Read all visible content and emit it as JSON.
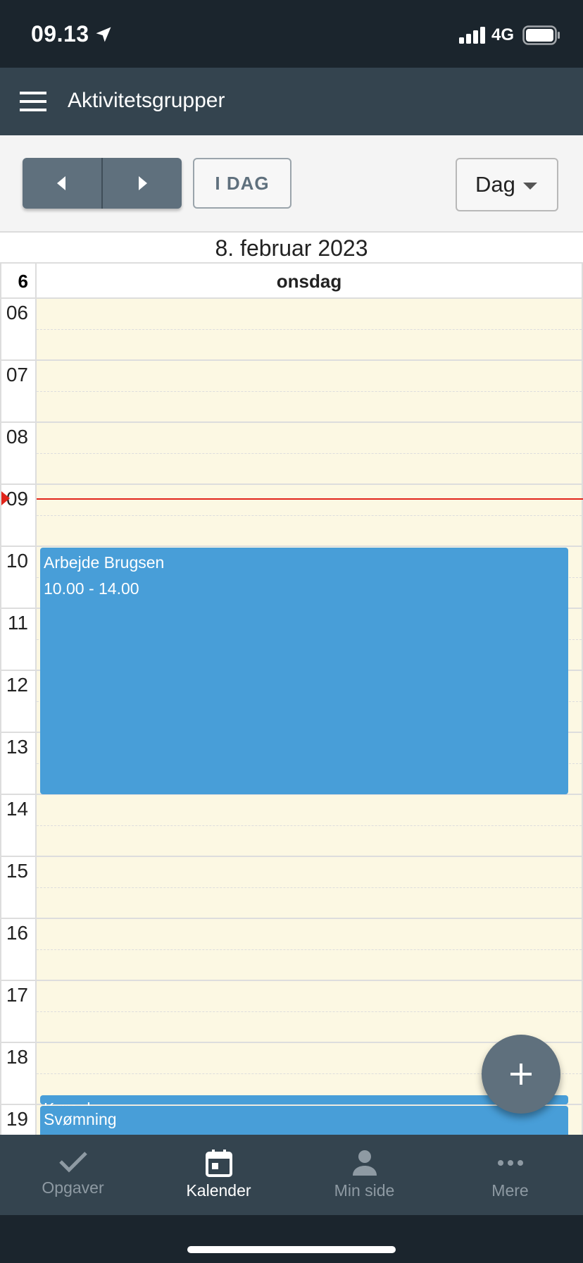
{
  "status_bar": {
    "time": "09.13",
    "network": "4G"
  },
  "app_bar": {
    "title": "Aktivitetsgrupper"
  },
  "toolbar": {
    "today_label": "I DAG",
    "view_selected": "Dag"
  },
  "calendar": {
    "date_title": "8. februar 2023",
    "week_number": "6",
    "day_name": "onsdag",
    "hours": [
      "06",
      "07",
      "08",
      "09",
      "10",
      "11",
      "12",
      "13",
      "14",
      "15",
      "16",
      "17",
      "18",
      "19"
    ],
    "now_time": "09:13",
    "events": [
      {
        "title": "Arbejde Brugsen",
        "time": "10.00 - 14.00",
        "color": "#489ed8"
      },
      {
        "title": "Kørsel",
        "color": "#489ed8"
      },
      {
        "title": "Svømning",
        "color": "#489ed8"
      }
    ]
  },
  "bottom_nav": {
    "tabs": [
      {
        "label": "Opgaver",
        "icon": "check-icon",
        "active": false
      },
      {
        "label": "Kalender",
        "icon": "calendar-icon",
        "active": true
      },
      {
        "label": "Min side",
        "icon": "person-icon",
        "active": false
      },
      {
        "label": "Mere",
        "icon": "more-icon",
        "active": false
      }
    ]
  },
  "colors": {
    "accent": "#489ed8",
    "header": "#34444f",
    "slot_bg": "#fcf8e3",
    "now_line": "#e1251b"
  }
}
